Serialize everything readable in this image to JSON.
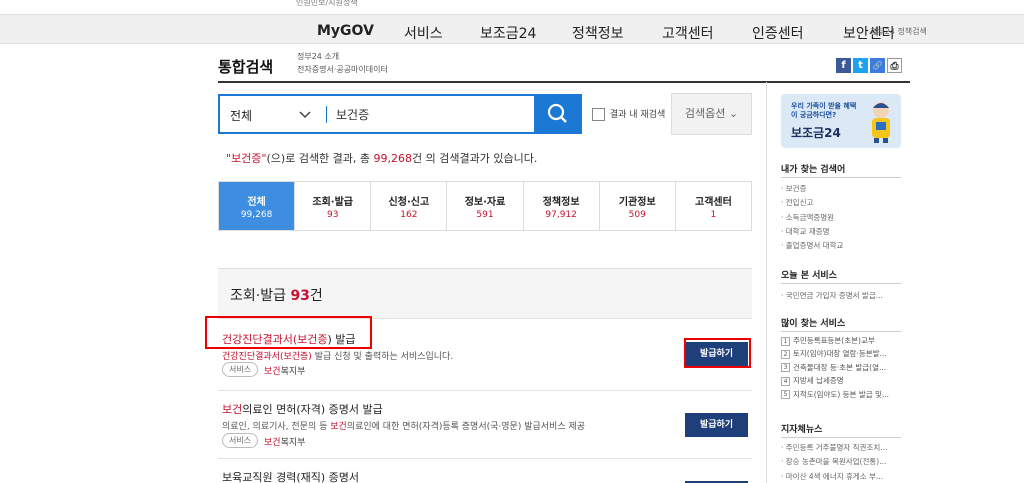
{
  "topbar": {
    "text": "인원민보/지원정책"
  },
  "nav": {
    "items": [
      "MyGOV",
      "서비스",
      "보조금24",
      "정책정보",
      "고객센터",
      "인증센터",
      "보안센터"
    ],
    "sub": "정부24 정책검색"
  },
  "header": {
    "title": "통합검색",
    "links": [
      "정부24 소개",
      "전자증명서·공공마이데이터"
    ],
    "share": {
      "facebook": "f",
      "twitter": "t",
      "link": "🔗",
      "print": "⎙"
    }
  },
  "search": {
    "scope": "전체",
    "query": "보건증",
    "within_label": "결과 내 재검색",
    "options_label": "검색옵션",
    "options_chevron": "⌄"
  },
  "result": {
    "open_quote": "\"",
    "keyword": "보건증",
    "close_quote": "\"",
    "text_1": "(으)로 검색한 결과, 총 ",
    "count": "99,268",
    "text_2": "건 의 검색결과가 있습니다."
  },
  "tabs": [
    {
      "label": "전체",
      "count": "99,268"
    },
    {
      "label": "조회·발급",
      "count": "93"
    },
    {
      "label": "신청·신고",
      "count": "162"
    },
    {
      "label": "정보·자료",
      "count": "591"
    },
    {
      "label": "정책정보",
      "count": "97,912"
    },
    {
      "label": "기관정보",
      "count": "509"
    },
    {
      "label": "고객센터",
      "count": "1"
    }
  ],
  "section": {
    "title": "조회·발급",
    "count": "93",
    "suffix": "건"
  },
  "items": [
    {
      "title_pre": "건강진단결과서(",
      "title_hl": "보건증",
      "title_post": ") 발급",
      "desc_hl": "건강진단결과서(보건증)",
      "desc_post": " 발급 신청 및 출력하는 서비스입니다.",
      "badge": "서비스",
      "org_hl": "보건",
      "org_post": "복지부",
      "button": "발급하기"
    },
    {
      "title_hl": "보건",
      "title_post": "의료인 면허(자격) 증명서 발급",
      "desc_pre": "의료인, 의료기사, 전문의 등 ",
      "desc_hl": "보건",
      "desc_post": "의료인에 대한 면허(자격)등록 증명서(국·영문) 발급서비스 제공",
      "badge": "서비스",
      "org_hl": "보건",
      "org_post": "복지부",
      "button": "발급하기"
    },
    {
      "title_post": "보육교직원 경력(재직) 증명서"
    }
  ],
  "sidebar": {
    "banner": {
      "line1": "우리 가족이 받을 혜택이 궁금하다면?",
      "line2": "보조금24"
    },
    "popular_title": "내가 찾는 검색어",
    "popular": [
      "보건증",
      "전입신고",
      "소득금액증명원",
      "대학교 재증명",
      "졸업증명서 대학교"
    ],
    "recent_title": "오늘 본 서비스",
    "recent": [
      "국민연금 가입자 증명서 발급..."
    ],
    "frequent_title": "많이 찾는 서비스",
    "frequent": [
      "주민등록표등본(초본)교부",
      "토지(임야)대장 열람·등본발...",
      "건축물대장 등·초본 발급(열...",
      "지방세 납세증명",
      "지적도(임야도) 등본 발급 및..."
    ],
    "news_title": "지자체뉴스",
    "news": [
      "주민등록 거주불명자 직권조치...",
      "장승 농촌마을 복원사업(전통)...",
      "마이산 4색 에너지 휴게소 부..."
    ]
  }
}
